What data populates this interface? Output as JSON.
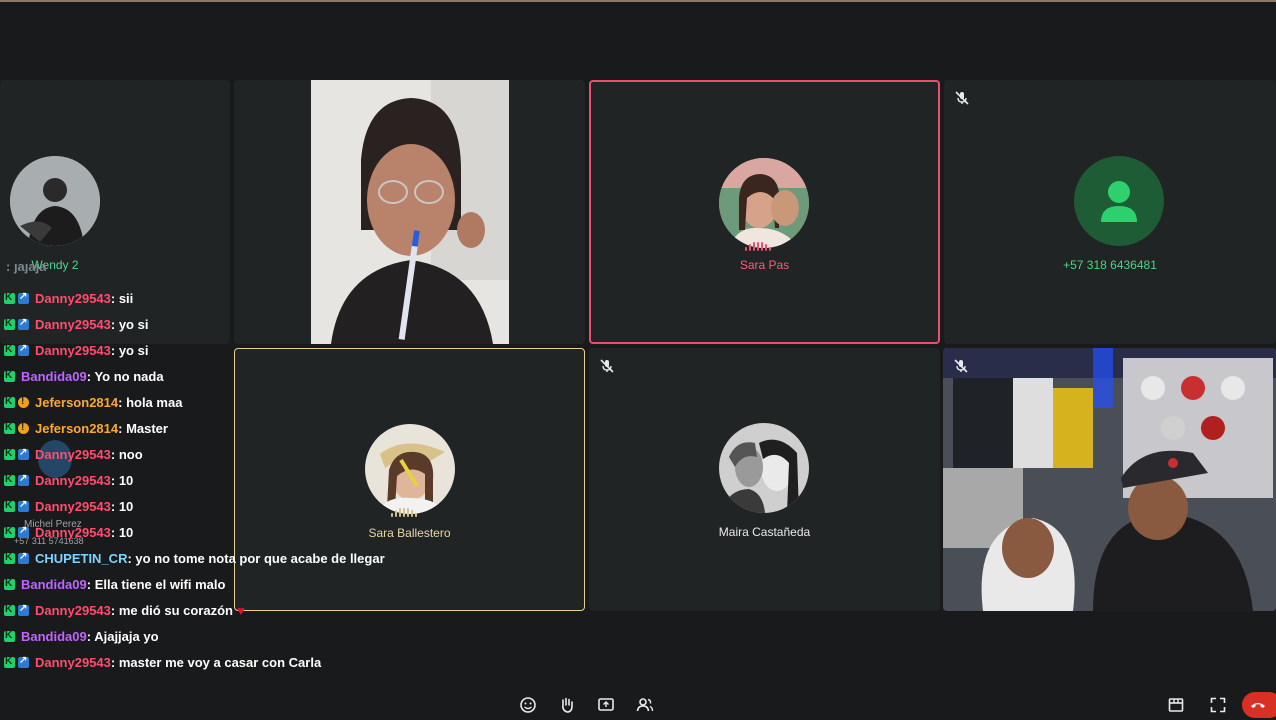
{
  "participants": {
    "wendy": {
      "name": "Wendy 2"
    },
    "sara_pas": {
      "name": "Sara Pas"
    },
    "phone": {
      "name": "+57 318 6436481"
    },
    "sara_ballestero": {
      "name": "Sara Ballestero"
    },
    "maira": {
      "name": "Maira Castañeda"
    },
    "michel": {
      "name": "Michel Perez",
      "phone": "+57 311 5741638"
    }
  },
  "chat": {
    "partial_top": ": jajaja",
    "messages": [
      {
        "user": "Danny29543",
        "text": ": sii",
        "badges": [
          "k",
          "s"
        ],
        "color": "#ff4d6d"
      },
      {
        "user": "Danny29543",
        "text": ": yo si",
        "badges": [
          "k",
          "s"
        ],
        "color": "#ff4d6d"
      },
      {
        "user": "Danny29543",
        "text": ": yo si",
        "badges": [
          "k",
          "s"
        ],
        "color": "#ff4d6d"
      },
      {
        "user": "Bandida09",
        "text": ": Yo no nada",
        "badges": [
          "k"
        ],
        "color": "#c264ff"
      },
      {
        "user": "Jeferson2814",
        "text": ": hola maa",
        "badges": [
          "k",
          "warn"
        ],
        "color": "#ffa733"
      },
      {
        "user": "Jeferson2814",
        "text": ": Master",
        "badges": [
          "k",
          "warn"
        ],
        "color": "#ffa733"
      },
      {
        "user": "Danny29543",
        "text": ": noo",
        "badges": [
          "k",
          "s"
        ],
        "color": "#ff4d6d"
      },
      {
        "user": "Danny29543",
        "text": ": 10",
        "badges": [
          "k",
          "s"
        ],
        "color": "#ff4d6d"
      },
      {
        "user": "Danny29543",
        "text": ": 10",
        "badges": [
          "k",
          "s"
        ],
        "color": "#ff4d6d"
      },
      {
        "user": "Danny29543",
        "text": ": 10",
        "badges": [
          "k",
          "s"
        ],
        "color": "#ff4d6d"
      },
      {
        "user": "CHUPETIN_CR",
        "text": ": yo no tome nota por que acabe de llegar",
        "badges": [
          "k",
          "s"
        ],
        "color": "#7fd3ff"
      },
      {
        "user": "Bandida09",
        "text": ": Ella tiene el wifi malo",
        "badges": [
          "k"
        ],
        "color": "#c264ff"
      },
      {
        "user": "Danny29543",
        "text": ": me dió su corazón",
        "badges": [
          "k",
          "s"
        ],
        "color": "#ff4d6d",
        "heart": "♥"
      },
      {
        "user": "Bandida09",
        "text": ": Ajajjaja yo",
        "badges": [
          "k"
        ],
        "color": "#c264ff"
      },
      {
        "user": "Danny29543",
        "text": ": master me voy a casar con Carla",
        "badges": [
          "k",
          "s"
        ],
        "color": "#ff4d6d"
      }
    ]
  },
  "colors": {
    "active_speaker_border": "#e8506e",
    "speaking_border": "#e8cf95",
    "phone_avatar_bg": "#1e5c36",
    "phone_icon": "#2ed06e",
    "phone_name": "#4ed386"
  },
  "icons": {
    "toolbar_center": [
      "emoji-icon",
      "raise-hand-icon",
      "present-screen-icon",
      "people-icon"
    ],
    "toolbar_right": [
      "layout-icon",
      "fullscreen-icon",
      "hang-up-icon"
    ]
  }
}
